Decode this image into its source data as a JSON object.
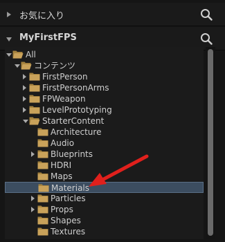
{
  "favorites": {
    "label": "お気に入り",
    "expanded": false
  },
  "project": {
    "label": "MyFirstFPS",
    "expanded": true
  },
  "tree": [
    {
      "label": "All",
      "depth": 0,
      "twisty": "down",
      "folder": "open"
    },
    {
      "label": "コンテンツ",
      "depth": 1,
      "twisty": "down",
      "folder": "open"
    },
    {
      "label": "FirstPerson",
      "depth": 2,
      "twisty": "right",
      "folder": "closed"
    },
    {
      "label": "FirstPersonArms",
      "depth": 2,
      "twisty": "right",
      "folder": "closed"
    },
    {
      "label": "FPWeapon",
      "depth": 2,
      "twisty": "right",
      "folder": "closed"
    },
    {
      "label": "LevelPrototyping",
      "depth": 2,
      "twisty": "right",
      "folder": "closed"
    },
    {
      "label": "StarterContent",
      "depth": 2,
      "twisty": "down",
      "folder": "open"
    },
    {
      "label": "Architecture",
      "depth": 3,
      "twisty": "none",
      "folder": "closed"
    },
    {
      "label": "Audio",
      "depth": 3,
      "twisty": "none",
      "folder": "closed"
    },
    {
      "label": "Blueprints",
      "depth": 3,
      "twisty": "right",
      "folder": "closed"
    },
    {
      "label": "HDRI",
      "depth": 3,
      "twisty": "none",
      "folder": "closed"
    },
    {
      "label": "Maps",
      "depth": 3,
      "twisty": "none",
      "folder": "closed"
    },
    {
      "label": "Materials",
      "depth": 3,
      "twisty": "none",
      "folder": "closed",
      "selected": true
    },
    {
      "label": "Particles",
      "depth": 3,
      "twisty": "right",
      "folder": "closed"
    },
    {
      "label": "Props",
      "depth": 3,
      "twisty": "right",
      "folder": "closed"
    },
    {
      "label": "Shapes",
      "depth": 3,
      "twisty": "none",
      "folder": "closed"
    },
    {
      "label": "Textures",
      "depth": 3,
      "twisty": "none",
      "folder": "closed"
    }
  ],
  "colors": {
    "folder": "#c9a25a",
    "folder_dark": "#a7843f",
    "selected": "#3c4d60",
    "annotation_arrow": "#e0201c"
  }
}
